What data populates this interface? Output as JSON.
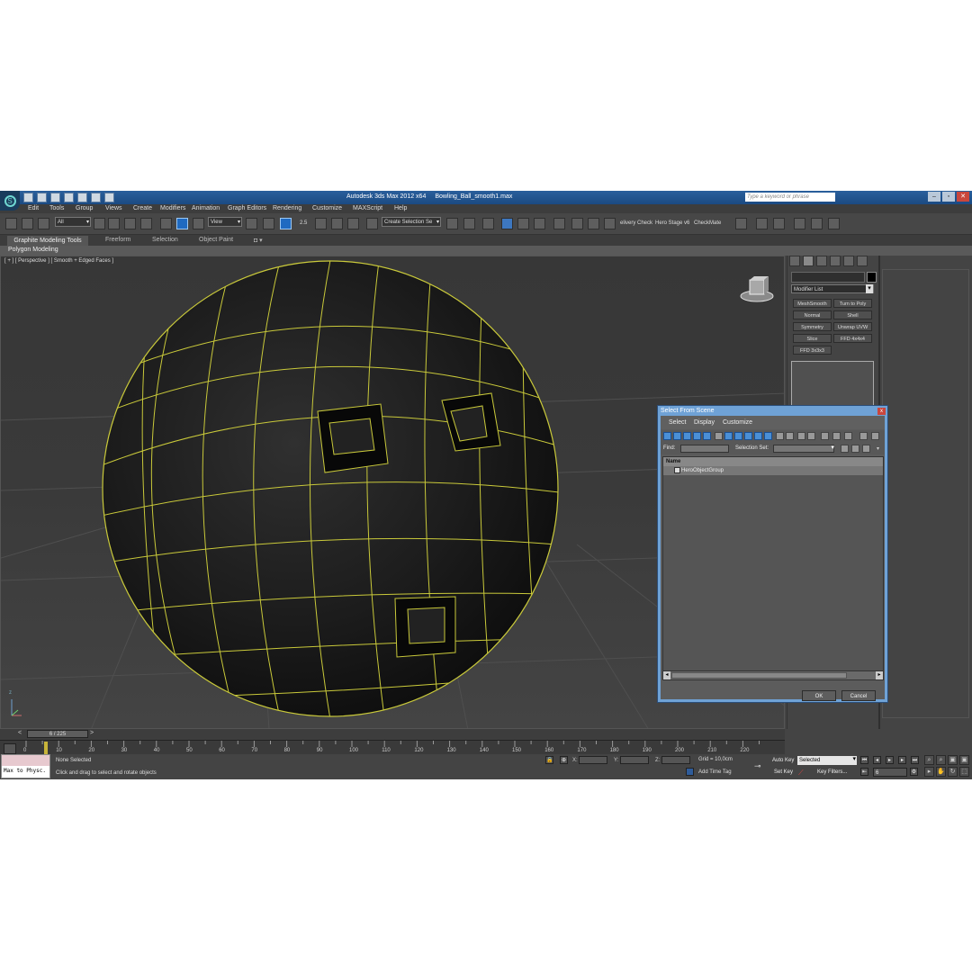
{
  "titlebar": {
    "app_title": "Autodesk 3ds Max  2012 x64",
    "file_name": "Bowling_Ball_smooth1.max",
    "search_placeholder": "Type a keyword or phrase",
    "min": "–",
    "max": "▫",
    "close": "✕"
  },
  "menu": [
    "Edit",
    "Tools",
    "Group",
    "Views",
    "Create",
    "Modifiers",
    "Animation",
    "Graph Editors",
    "Rendering",
    "Customize",
    "MAXScript",
    "Help"
  ],
  "toolbar": {
    "filter": "All",
    "ref_coord": "View",
    "selection_set": "Create Selection Se",
    "snap_text": "2.5",
    "plugin_text": "elivery Check",
    "plugin_text2": "Hero Stage v6",
    "plugin_text3": "CheckMate"
  },
  "ribbon": {
    "tabs": [
      "Graphite Modeling Tools",
      "Freeform",
      "Selection",
      "Object Paint"
    ],
    "tab_extra": "◘ ▾",
    "panel": "Polygon Modeling"
  },
  "viewport": {
    "label": "[ + ] [ Perspective ] [ Smooth + Edged Faces ]",
    "axis_label": "z"
  },
  "command_panel": {
    "modifier_list": "Modifier List",
    "buttons": [
      "MeshSmooth",
      "Turn to Poly",
      "Normal",
      "Shell",
      "Symmetry",
      "Unwrap UVW",
      "Slice",
      "FFD 4x4x4",
      "FFD 3x3x3"
    ]
  },
  "dialog": {
    "title": "Select From Scene",
    "close": "x",
    "menu": [
      "Select",
      "Display",
      "Customize"
    ],
    "find_label": "Find:",
    "selection_set_label": "Selection Set:",
    "column_name": "Name",
    "rows": [
      "HeroObjectGroup"
    ],
    "ok": "OK",
    "cancel": "Cancel"
  },
  "timeline": {
    "frame_indicator": "6 / 225",
    "ticks": [
      "0",
      "10",
      "20",
      "30",
      "40",
      "50",
      "60",
      "70",
      "80",
      "90",
      "100",
      "110",
      "120",
      "130",
      "140",
      "150",
      "160",
      "170",
      "180",
      "190",
      "200",
      "210",
      "220"
    ],
    "prev": "<",
    "next": ">"
  },
  "status": {
    "maxscript": "Max to Physc.",
    "selection": "None Selected",
    "prompt": "Click and drag to select and rotate objects",
    "x_label": "X:",
    "y_label": "Y:",
    "z_label": "Z:",
    "grid": "Grid = 10,0cm",
    "add_time_tag": "Add Time Tag",
    "auto_key": "Auto Key",
    "set_key": "Set Key",
    "key_mode": "Selected",
    "key_filters": "Key Filters...",
    "frame": "6"
  },
  "colors": {
    "wire": "#c9c93a",
    "ball": "#1a1a1a",
    "title_blue": "#2a5f9c"
  }
}
